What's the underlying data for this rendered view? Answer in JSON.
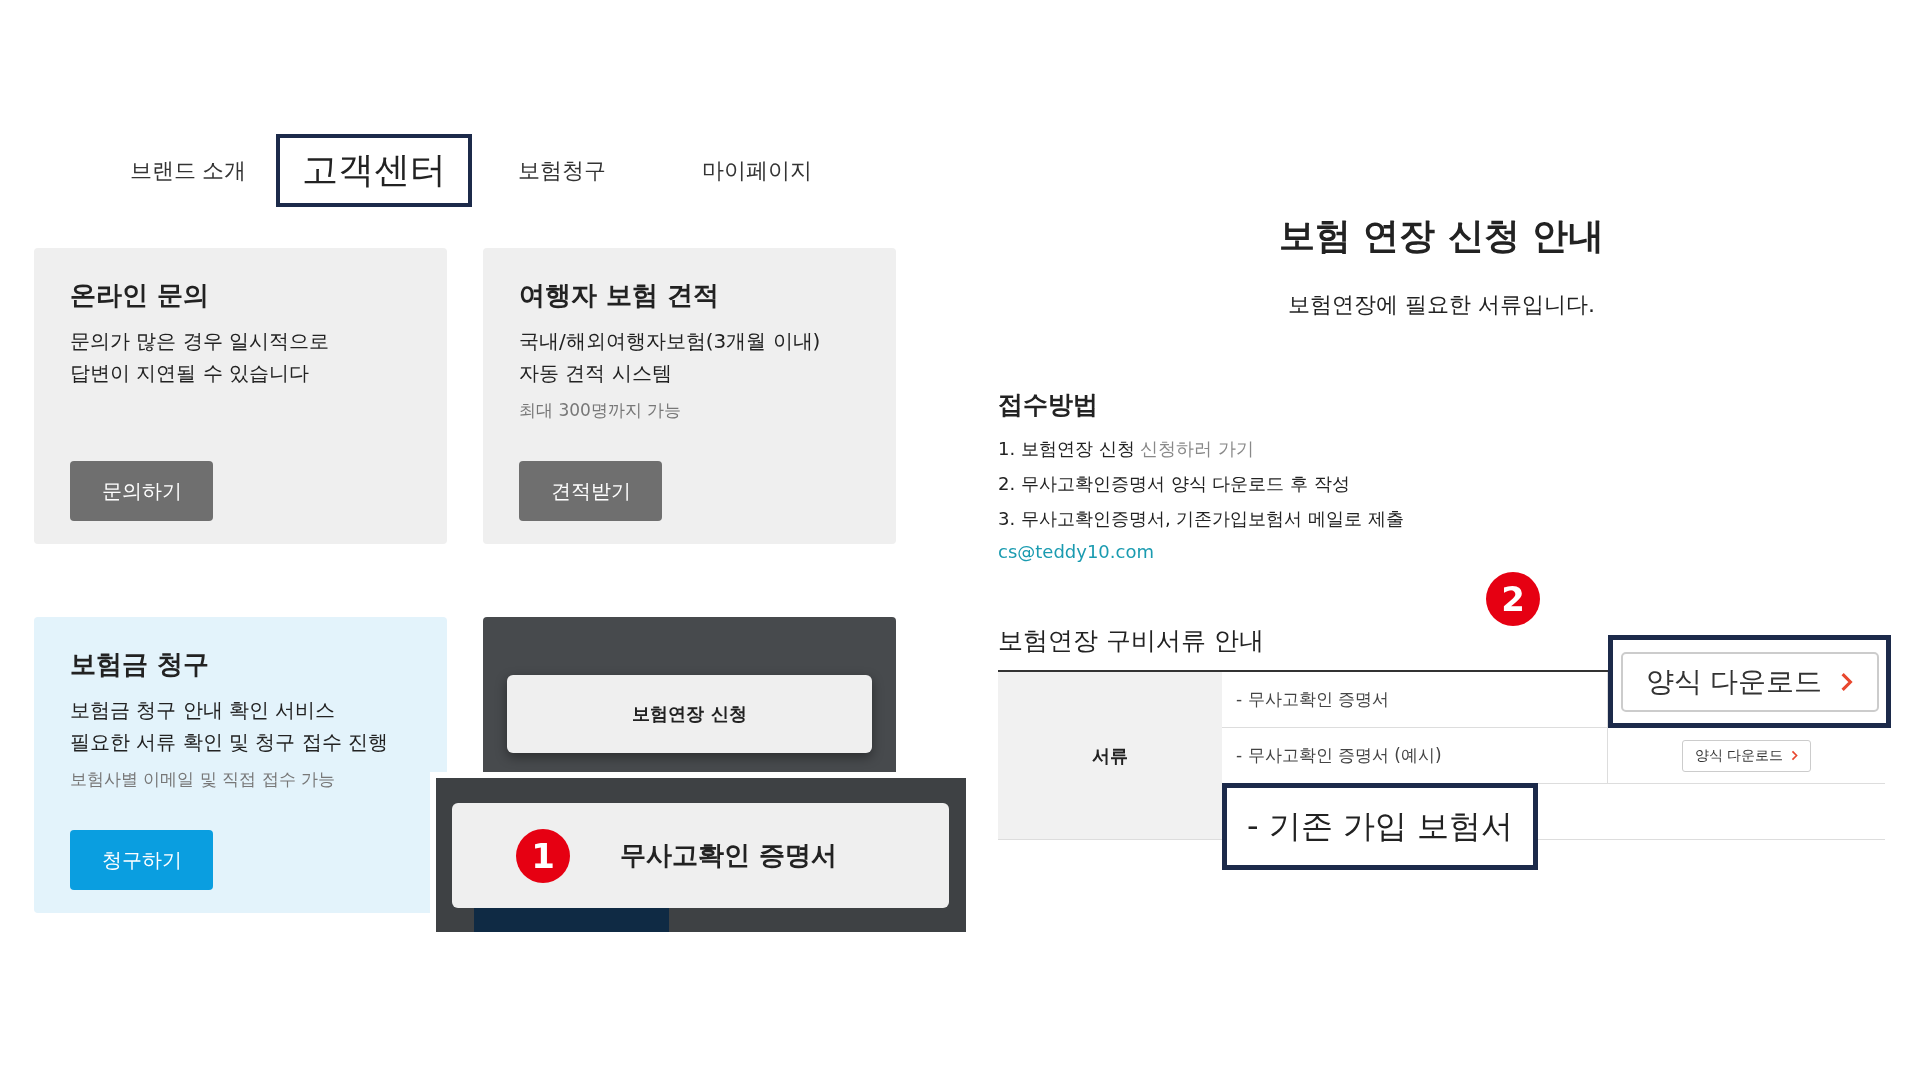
{
  "nav": {
    "tabs": [
      {
        "label": "브랜드 소개",
        "selected": false
      },
      {
        "label": "고객센터",
        "selected": true
      },
      {
        "label": "보험청구",
        "selected": false
      },
      {
        "label": "마이페이지",
        "selected": false
      }
    ]
  },
  "cards": [
    {
      "kind": "light",
      "title": "온라인 문의",
      "description": [
        "문의가 많은 경우 일시적으로",
        "답변이 지연될 수 있습니다"
      ],
      "button": "문의하기"
    },
    {
      "kind": "light",
      "title": "여행자 보험 견적",
      "description": [
        "국내/해외여행자보험(3개월 이내)",
        "자동 견적 시스템"
      ],
      "note": "최대 300명까지 가능",
      "button": "견적받기"
    },
    {
      "kind": "blue",
      "title": "보험금 청구",
      "description": [
        "보험금 청구 안내 확인 서비스",
        "필요한 서류 확인 및 청구 접수 진행"
      ],
      "note": "보험사별 이메일 및 직접 접수 가능",
      "button": "청구하기"
    },
    {
      "kind": "dark",
      "popup": "보험연장 신청"
    }
  ],
  "callout": {
    "badge": "1",
    "label": "무사고확인 증명서"
  },
  "guide": {
    "title": "보험 연장 신청 안내",
    "subtitle": "보험연장에 필요한 서류입니다.",
    "method": {
      "heading": "접수방법",
      "steps": [
        {
          "text": "1. 보험연장 신청",
          "link": "신청하러 가기"
        },
        {
          "text": "2. 무사고확인증명서 양식 다운로드 후 작성"
        },
        {
          "text": "3. 무사고확인증명서, 기존가입보험서 메일로 제출"
        }
      ],
      "email": "cs@teddy10.com"
    },
    "documents": {
      "heading": "보험연장 구비서류 안내",
      "badge": "2",
      "header_cell": "서류",
      "rows": [
        {
          "name": "- 무사고확인 증명서",
          "button": "양식 다운로드",
          "emphasis": true
        },
        {
          "name": "- 무사고확인 증명서 (예시)",
          "button": "양식 다운로드",
          "emphasis": false
        },
        {
          "name": "- 기존 가입 보험서",
          "emphasis": true
        }
      ]
    }
  }
}
